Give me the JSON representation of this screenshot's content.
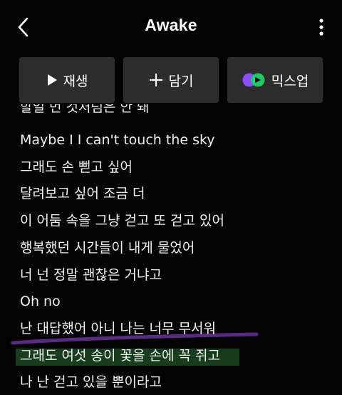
{
  "header": {
    "title": "Awake",
    "back_icon": "chevron-left-icon",
    "more_icon": "more-vertical-icon"
  },
  "actions": {
    "play_label": "재생",
    "add_label": "담기",
    "mixup_label": "믹스업"
  },
  "lyrics": {
    "partial_line": "할일 번 것처럼은 안 돼",
    "lines": [
      "Maybe I I can't touch the sky",
      "그래도 손 뻗고 싶어",
      "달려보고 싶어 조금 더",
      "이 어둠 속을 그냥 걷고 또 걷고 있어",
      "행복했던 시간들이 내게 물었어",
      "너 넌 정말 괜찮은 거냐고",
      "Oh no",
      "난 대답했어 아니 나는 너무 무서워",
      "그래도 여섯 송이 꽃을 손에 꼭 쥐고",
      "나 난 걷고 있을 뿐이라고"
    ]
  },
  "colors": {
    "background": "#030303",
    "button_bg": "#2c2c2c",
    "highlight_green": "#2a6e32",
    "highlight_purple": "#5a2a86",
    "mixup_green": "#1ed760",
    "mixup_purple": "#8a4dff"
  }
}
